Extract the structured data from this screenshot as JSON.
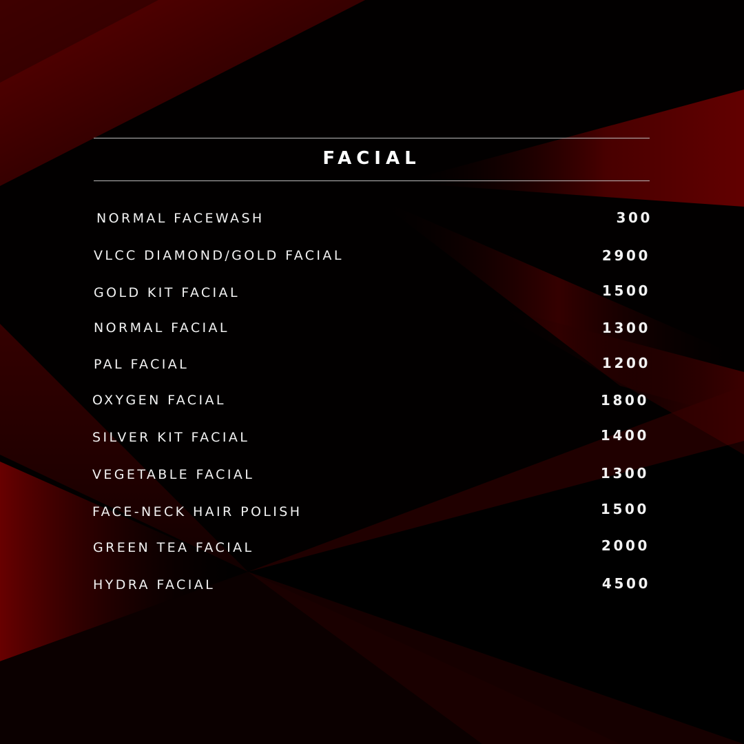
{
  "menu": {
    "title": "FACIAL",
    "items": [
      {
        "name": "NORMAL FACEWASH",
        "price": "300"
      },
      {
        "name": "VLCC DIAMOND/GOLD FACIAL",
        "price": "2900"
      },
      {
        "name": "GOLD KIT FACIAL",
        "price": "1500"
      },
      {
        "name": "NORMAL FACIAL",
        "price": "1300"
      },
      {
        "name": "PAL FACIAL",
        "price": "1200"
      },
      {
        "name": "OXYGEN FACIAL",
        "price": "1800"
      },
      {
        "name": "SILVER KIT FACIAL",
        "price": "1400"
      },
      {
        "name": "VEGETABLE FACIAL",
        "price": "1300"
      },
      {
        "name": "FACE-NECK HAIR POLISH",
        "price": "1500"
      },
      {
        "name": "GREEN TEA FACIAL",
        "price": "2000"
      },
      {
        "name": "HYDRA FACIAL",
        "price": "4500"
      }
    ]
  },
  "colors": {
    "background": "#030000",
    "accent_red": "#8a0000",
    "text": "#f2f2f2",
    "rule": "#bdbdbd"
  }
}
